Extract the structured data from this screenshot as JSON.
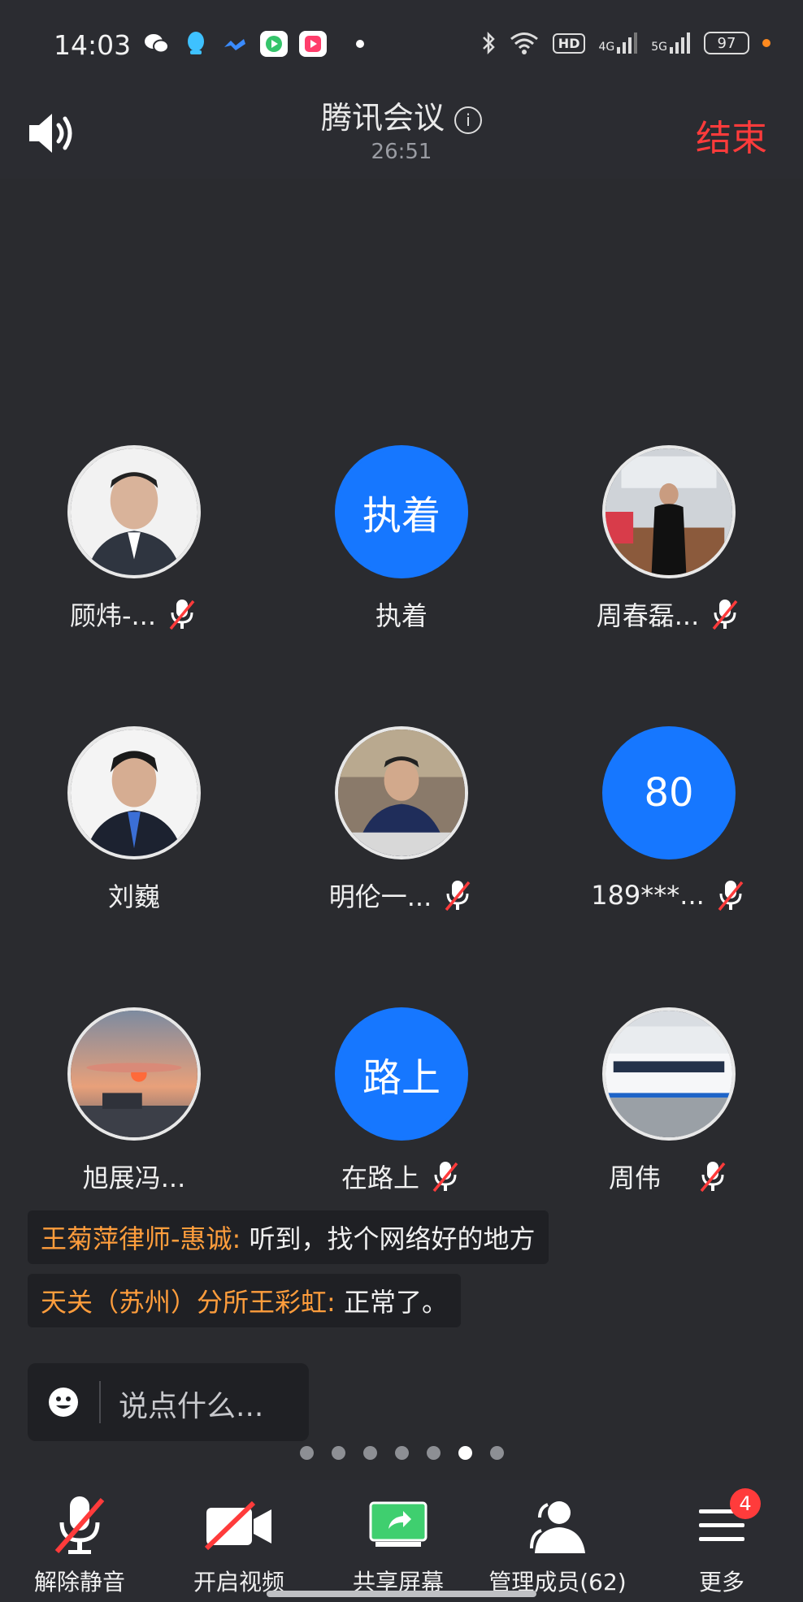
{
  "status_bar": {
    "time": "14:03",
    "hd_label": "HD",
    "net_4g": "4G",
    "net_5g": "5G",
    "battery": "97"
  },
  "header": {
    "title": "腾讯会议",
    "duration": "26:51",
    "end_label": "结束"
  },
  "participants": [
    {
      "name": "顾炜-...",
      "avatar_text": "",
      "muted": true
    },
    {
      "name": "执着",
      "avatar_text": "执着",
      "muted": false
    },
    {
      "name": "周春磊...",
      "avatar_text": "",
      "muted": true
    },
    {
      "name": "刘巍",
      "avatar_text": "",
      "muted": false
    },
    {
      "name": "明伦一...",
      "avatar_text": "",
      "muted": true
    },
    {
      "name": "189***...",
      "avatar_text": "80",
      "muted": true
    },
    {
      "name": "旭展冯...",
      "avatar_text": "",
      "muted": false
    },
    {
      "name": "在路上",
      "avatar_text": "路上",
      "muted": true
    },
    {
      "name": "周伟",
      "avatar_text": "",
      "muted": true
    }
  ],
  "chat": [
    {
      "sender": "王菊萍律师-惠诚:",
      "text": " 听到，找个网络好的地方"
    },
    {
      "sender": "天关（苏州）分所王彩虹:",
      "text": " 正常了。"
    }
  ],
  "chat_input": {
    "placeholder": "说点什么..."
  },
  "pager": {
    "total": 7,
    "active_index": 5
  },
  "toolbar": {
    "unmute": "解除静音",
    "video": "开启视频",
    "share": "共享屏幕",
    "members": "管理成员(62)",
    "more": "更多",
    "more_badge": "4"
  },
  "colors": {
    "accent_blue": "#1677ff",
    "end_red": "#ff3b3b",
    "sender_orange": "#ff9d3c",
    "share_green": "#3fcf6f"
  }
}
